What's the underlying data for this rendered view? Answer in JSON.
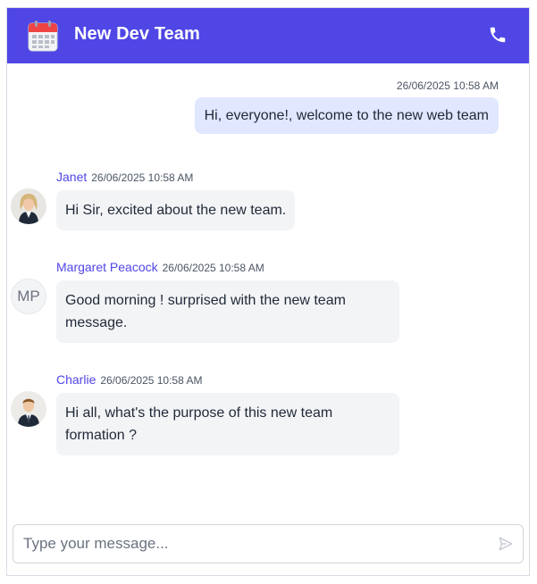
{
  "header": {
    "title": "New Dev Team",
    "calendar_icon": "calendar-icon",
    "call_icon": "phone-icon",
    "background": "#4f46e5"
  },
  "messages": [
    {
      "own": true,
      "time": "26/06/2025 10:58 AM",
      "text": "Hi, everyone!, welcome to the new web team"
    },
    {
      "own": false,
      "author": "Janet",
      "avatar": "photo",
      "time": "26/06/2025 10:58 AM",
      "text": "Hi Sir, excited about the new team."
    },
    {
      "own": false,
      "author": "Margaret Peacock",
      "avatar_initials": "MP",
      "time": "26/06/2025 10:58 AM",
      "text": "Good morning ! surprised with the new team message."
    },
    {
      "own": false,
      "author": "Charlie",
      "avatar": "photo",
      "time": "26/06/2025 10:58 AM",
      "text": "Hi all, what's the purpose of this new team formation ?"
    }
  ],
  "composer": {
    "placeholder": "Type your message...",
    "send_icon": "send-icon"
  }
}
